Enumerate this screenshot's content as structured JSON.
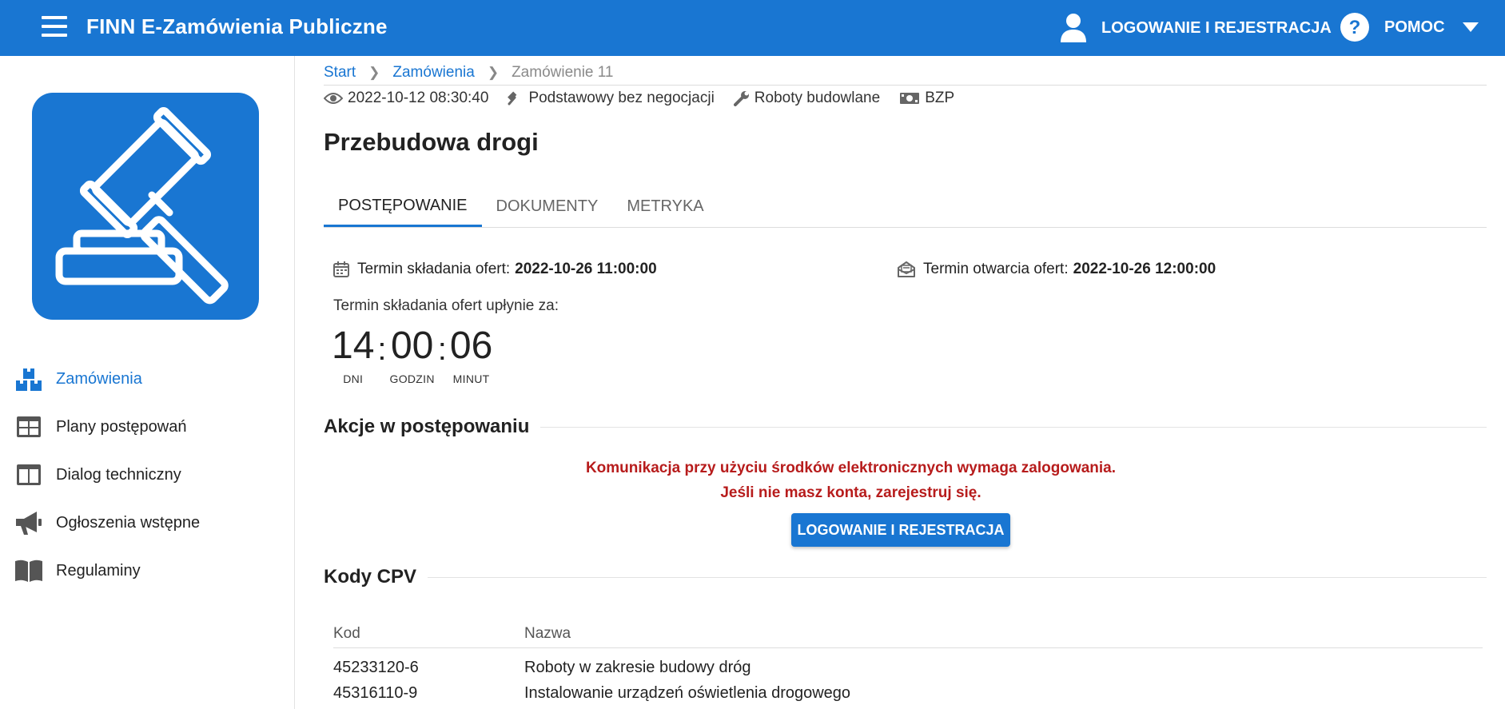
{
  "header": {
    "app_title": "FINN E-Zamówienia Publiczne",
    "login_label": "LOGOWANIE I REJESTRACJA",
    "help_label": "POMOC"
  },
  "sidebar": {
    "items": [
      {
        "label": "Zamówienia",
        "icon": "boxes-icon",
        "active": true
      },
      {
        "label": "Plany postępowań",
        "icon": "table-icon",
        "active": false
      },
      {
        "label": "Dialog techniczny",
        "icon": "columns-icon",
        "active": false
      },
      {
        "label": "Ogłoszenia wstępne",
        "icon": "megaphone-icon",
        "active": false
      },
      {
        "label": "Regulaminy",
        "icon": "book-icon",
        "active": false
      }
    ]
  },
  "breadcrumb": {
    "items": [
      "Start",
      "Zamówienia"
    ],
    "current": "Zamówienie 11"
  },
  "meta": {
    "date": "2022-10-12 08:30:40",
    "mode": "Podstawowy bez negocjacji",
    "type": "Roboty budowlane",
    "source": "BZP"
  },
  "title": "Przebudowa drogi",
  "tabs": [
    {
      "label": "POSTĘPOWANIE",
      "active": true
    },
    {
      "label": "DOKUMENTY",
      "active": false
    },
    {
      "label": "METRYKA",
      "active": false
    }
  ],
  "deadlines": {
    "submission_label": "Termin składania ofert:",
    "submission_value": "2022-10-26 11:00:00",
    "opening_label": "Termin otwarcia ofert:",
    "opening_value": "2022-10-26 12:00:00"
  },
  "countdown": {
    "label": "Termin składania ofert upłynie za:",
    "days": "14",
    "days_caption": "DNI",
    "hours": "00",
    "hours_caption": "GODZIN",
    "minutes": "06",
    "minutes_caption": "MINUT"
  },
  "actions": {
    "heading": "Akcje w postępowaniu",
    "warning_line1": "Komunikacja przy użyciu środków elektronicznych wymaga zalogowania.",
    "warning_line2": "Jeśli nie masz konta, zarejestruj się.",
    "button_label": "LOGOWANIE I REJESTRACJA"
  },
  "cpv": {
    "heading": "Kody CPV",
    "columns": [
      "Kod",
      "Nazwa"
    ],
    "rows": [
      {
        "code": "45233120-6",
        "name": "Roboty w zakresie budowy dróg"
      },
      {
        "code": "45316110-9",
        "name": "Instalowanie urządzeń oświetlenia drogowego"
      }
    ]
  },
  "colors": {
    "primary": "#1976d2",
    "warning": "#b71c1c"
  }
}
